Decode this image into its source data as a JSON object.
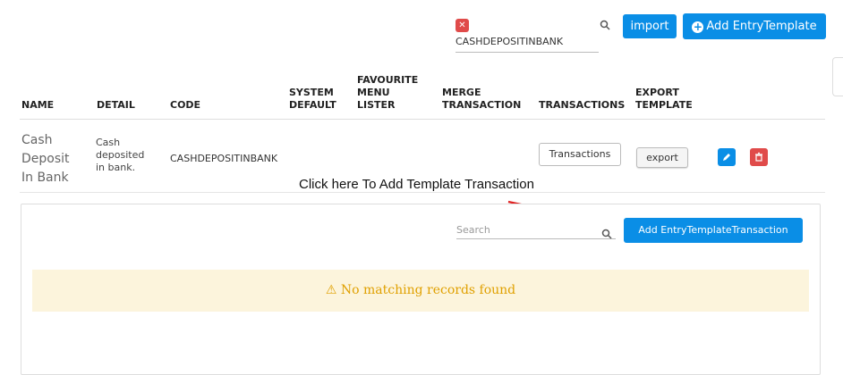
{
  "search": {
    "value": "CASHDEPOSITINBANK",
    "clear_icon": "close-icon",
    "icon": "search-icon"
  },
  "toolbar": {
    "import_label": "import",
    "add_entry_template_label": "Add EntryTemplate",
    "add_icon": "plus-circle-icon"
  },
  "table": {
    "headers": {
      "name": "NAME",
      "detail": "DETAIL",
      "code": "CODE",
      "system_default": [
        "SYSTEM",
        "DEFAULT"
      ],
      "favourite_menu_lister": [
        "FAVOURITE",
        "MENU",
        "LISTER"
      ],
      "merge_transaction": [
        "MERGE",
        "TRANSACTION"
      ],
      "transactions": "TRANSACTIONS",
      "export_template": [
        "EXPORT",
        "TEMPLATE"
      ]
    },
    "row": {
      "name": [
        "Cash",
        "Deposit",
        "In Bank"
      ],
      "detail": [
        "Cash",
        "deposited",
        "in bank."
      ],
      "code": "CASHDEPOSITINBANK",
      "transactions_button": "Transactions",
      "export_button": "export",
      "edit_icon": "pencil-icon",
      "delete_icon": "trash-icon"
    }
  },
  "annotation": {
    "text": "Click here To Add Template Transaction",
    "color": "#e02020"
  },
  "transactions_panel": {
    "search_placeholder": "Search",
    "add_button_label": "Add EntryTemplateTransaction",
    "empty_message": "No matching records found",
    "warning_icon": "warning-icon"
  },
  "colors": {
    "primary": "#0a8ee6",
    "danger": "#e04b4a",
    "warning_bg": "#fcf4dc",
    "warning_text": "#e0a000"
  }
}
